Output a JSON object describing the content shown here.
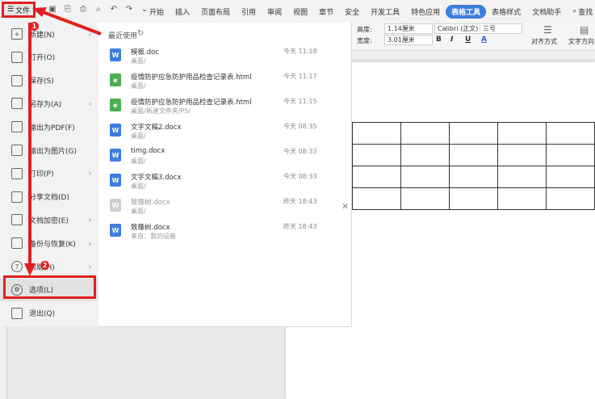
{
  "toolbar": {
    "file_label": "文件",
    "tabs": [
      "开始",
      "插入",
      "页面布局",
      "引用",
      "审阅",
      "视图",
      "章节",
      "安全",
      "开发工具",
      "特色应用",
      "表格工具",
      "表格样式",
      "文档助手"
    ],
    "active_tab": "表格工具",
    "search_label": "查找"
  },
  "ribbon": {
    "height_label": "高度:",
    "height_value": "1.14厘米",
    "width_label": "宽度:",
    "width_value": "3.01厘米",
    "font_name": "Calibri (正文)",
    "font_size": "三号",
    "bold": "B",
    "italic": "I",
    "underline": "U",
    "font_color": "A",
    "align_label": "对齐方式",
    "text_dir_label": "文字方向"
  },
  "menu": {
    "items": [
      {
        "label": "新建(N)",
        "icon": "new-doc-icon",
        "glyph": "+",
        "arrow": true
      },
      {
        "label": "打开(O)",
        "icon": "folder-icon",
        "glyph": "",
        "arrow": false
      },
      {
        "label": "保存(S)",
        "icon": "save-icon",
        "glyph": "",
        "arrow": false
      },
      {
        "label": "另存为(A)",
        "icon": "save-as-icon",
        "glyph": "",
        "arrow": true
      },
      {
        "label": "输出为PDF(F)",
        "icon": "pdf-icon",
        "glyph": "",
        "arrow": false
      },
      {
        "label": "输出为图片(G)",
        "icon": "image-icon",
        "glyph": "",
        "arrow": false
      },
      {
        "label": "打印(P)",
        "icon": "printer-icon",
        "glyph": "",
        "arrow": true
      },
      {
        "label": "分享文档(D)",
        "icon": "share-icon",
        "glyph": "",
        "arrow": false
      },
      {
        "label": "文档加密(E)",
        "icon": "lock-doc-icon",
        "glyph": "",
        "arrow": true
      },
      {
        "label": "备份与恢复(K)",
        "icon": "backup-icon",
        "glyph": "",
        "arrow": true
      },
      {
        "label": "帮助(H)",
        "icon": "help-icon",
        "glyph": "?",
        "arrow": true
      },
      {
        "label": "选项(L)",
        "icon": "gear-icon",
        "glyph": "⚙",
        "arrow": false
      },
      {
        "label": "退出(Q)",
        "icon": "exit-icon",
        "glyph": "",
        "arrow": false
      }
    ]
  },
  "recent": {
    "title": "最近使用",
    "files": [
      {
        "name": "模板.doc",
        "path": "桌面/",
        "time": "今天 11:18",
        "type": "doc"
      },
      {
        "name": "疫情防护应急防护用品检查记录表.html",
        "path": "桌面/",
        "time": "今天 11:17",
        "type": "html"
      },
      {
        "name": "疫情防护应急防护用品检查记录表.html",
        "path": "桌面/新建文件夹/PS/",
        "time": "今天 11:15",
        "type": "html"
      },
      {
        "name": "文字文稿2.docx",
        "path": "桌面/",
        "time": "今天 08:35",
        "type": "doc"
      },
      {
        "name": "timg.docx",
        "path": "桌面/",
        "time": "今天 08:33",
        "type": "doc"
      },
      {
        "name": "文字文稿3.docx",
        "path": "桌面/",
        "time": "今天 08:33",
        "type": "doc"
      },
      {
        "name": "致橡树.docx",
        "path": "桌面/",
        "time": "昨天 18:43",
        "type": "grey"
      },
      {
        "name": "致橡树.docx",
        "path": "来自：我的设备",
        "time": "昨天 18:43",
        "type": "doc"
      }
    ]
  },
  "annotations": {
    "badge1": "1",
    "badge2": "2"
  },
  "colors": {
    "accent": "#3c7de0",
    "annotation": "#e02020",
    "doc_icon": "#3c7de0",
    "html_icon": "#4caf50"
  }
}
